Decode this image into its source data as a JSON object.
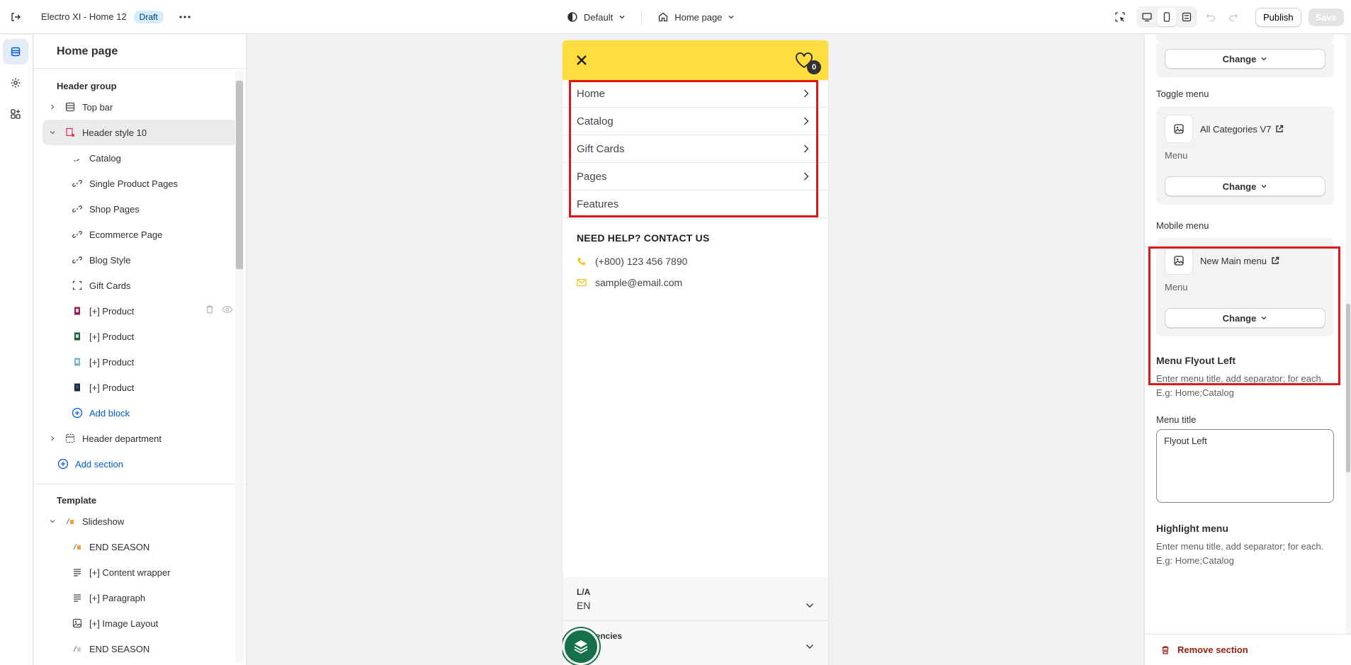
{
  "topbar": {
    "title": "Electro XI - Home 12",
    "status_badge": "Draft",
    "theme_select": "Default",
    "page_select": "Home page",
    "publish_label": "Publish",
    "save_label": "Save"
  },
  "left": {
    "title": "Home page",
    "header_group_title": "Header group",
    "header_items": [
      {
        "label": "Top bar"
      },
      {
        "label": "Header style 10"
      },
      {
        "label": "Catalog"
      },
      {
        "label": "Single Product Pages"
      },
      {
        "label": "Shop Pages"
      },
      {
        "label": "Ecommerce Page"
      },
      {
        "label": "Blog Style"
      },
      {
        "label": "Gift Cards"
      },
      {
        "label": "[+] Product"
      },
      {
        "label": "[+] Product"
      },
      {
        "label": "[+] Product"
      },
      {
        "label": "[+] Product"
      },
      {
        "label": "Add block"
      },
      {
        "label": "Header department"
      },
      {
        "label": "Add section"
      }
    ],
    "template_title": "Template",
    "template_items": [
      {
        "label": "Slideshow"
      },
      {
        "label": "END SEASON"
      },
      {
        "label": "[+] Content wrapper"
      },
      {
        "label": "[+] Paragraph"
      },
      {
        "label": "[+] Image Layout"
      },
      {
        "label": "END SEASON"
      }
    ]
  },
  "preview": {
    "accent_color": "#ffdd3f",
    "wishlist_count": "0",
    "menu": [
      "Home",
      "Catalog",
      "Gift Cards",
      "Pages",
      "Features"
    ],
    "help_title": "NEED HELP? CONTACT US",
    "phone": "(+800) 123 456 7890",
    "email": "sample@email.com",
    "language_label": "L/A",
    "language_value": "EN",
    "currency_label": "rencies"
  },
  "right": {
    "top_change_label": "Change",
    "toggle_menu_label": "Toggle menu",
    "toggle_menu_name": "All Categories V7",
    "toggle_menu_sub": "Menu",
    "toggle_change_label": "Change",
    "mobile_menu_label": "Mobile menu",
    "mobile_menu_name": "New Main menu",
    "mobile_menu_sub": "Menu",
    "mobile_change_label": "Change",
    "flyout_title": "Menu Flyout Left",
    "flyout_help": "Enter menu title, add separator; for each. E.g: Home;Catalog",
    "menu_title_label": "Menu title",
    "menu_title_value": "Flyout Left",
    "highlight_title": "Highlight menu",
    "highlight_help": "Enter menu title, add separator; for each. E.g: Home;Catalog",
    "remove_label": "Remove section"
  }
}
